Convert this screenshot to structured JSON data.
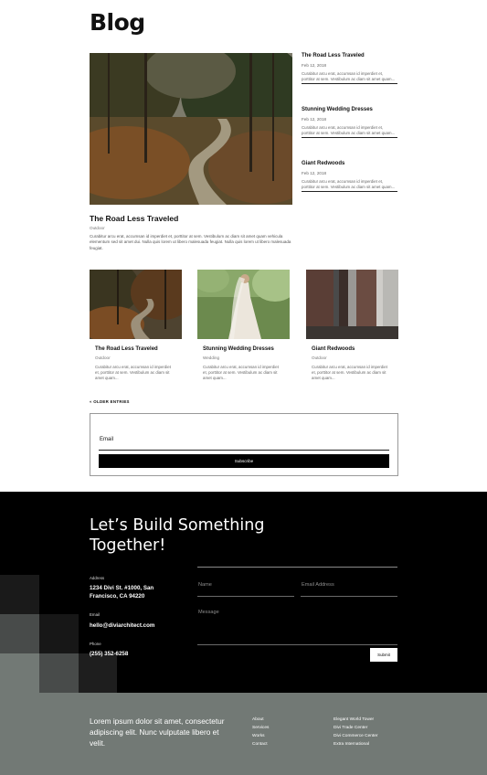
{
  "blog": {
    "title": "Blog",
    "featured": {
      "title": "The Road Less Traveled",
      "category": "Outdoor",
      "excerpt": "Curabitur arcu erat, accumsan id imperdiet et, porttitor at sem. Vestibulum ac diam sit amet quam vehicula elementum sed sit amet dui. Nulla quis lorem ut libero malesuada feugiat. Nulla quis lorem ut libero malesuada feugiat."
    },
    "side_posts": [
      {
        "title": "The Road Less Traveled",
        "date": "Feb 12, 2018",
        "excerpt": "Curabitur arcu erat, accumsan id imperdiet et, porttitor at sem. Vestibulum ac diam sit amet quam..."
      },
      {
        "title": "Stunning Wedding Dresses",
        "date": "Feb 12, 2018",
        "excerpt": "Curabitur arcu erat, accumsan id imperdiet et, porttitor at sem. Vestibulum ac diam sit amet quam..."
      },
      {
        "title": "Giant Redwoods",
        "date": "Feb 12, 2018",
        "excerpt": "Curabitur arcu erat, accumsan id imperdiet et, porttitor at sem. Vestibulum ac diam sit amet quam..."
      }
    ],
    "cards": [
      {
        "title": "The Road Less Traveled",
        "category": "Outdoor",
        "excerpt": "Curabitur arcu erat, accumsan id imperdiet et, porttitor at sem. Vestibulum ac diam sit amet quam..."
      },
      {
        "title": "Stunning Wedding Dresses",
        "category": "Wedding",
        "excerpt": "Curabitur arcu erat, accumsan id imperdiet et, porttitor at sem. Vestibulum ac diam sit amet quam..."
      },
      {
        "title": "Giant Redwoods",
        "category": "Outdoor",
        "excerpt": "Curabitur arcu erat, accumsan id imperdiet et, porttitor at sem. Vestibulum ac diam sit amet quam..."
      }
    ],
    "older_entries": "« OLDER ENTRIES"
  },
  "subscribe": {
    "email_label": "Email",
    "button_label": "Subscribe"
  },
  "contact": {
    "heading": "Let’s Build Something Together!",
    "address_label": "Address",
    "address_value": "1234 Divi St. #1000, San Francisco, CA 94220",
    "email_label": "Email",
    "email_value": "hello@diviarchitect.com",
    "phone_label": "Phone",
    "phone_value": "(255) 352-6258",
    "form": {
      "name_placeholder": "Name",
      "email_placeholder": "Email Address",
      "message_placeholder": "Message",
      "submit_label": "Submit"
    }
  },
  "footer": {
    "tagline": "Lorem ipsum dolor sit amet, consectetur adipiscing elit. Nunc vulputate libero et velit.",
    "nav_links": [
      "About",
      "Services",
      "Works",
      "Contact"
    ],
    "locations": [
      "Elegant World Tower",
      "Divi Trade Center",
      "Divi Commerce Center",
      "Extra International"
    ]
  },
  "colors": {
    "dark_band": "#000000",
    "footer_bg": "#727975",
    "accent_square_dark": "#1e1e1e",
    "accent_square_mid": "#4a4d4c",
    "accent_square_light": "#727975"
  }
}
